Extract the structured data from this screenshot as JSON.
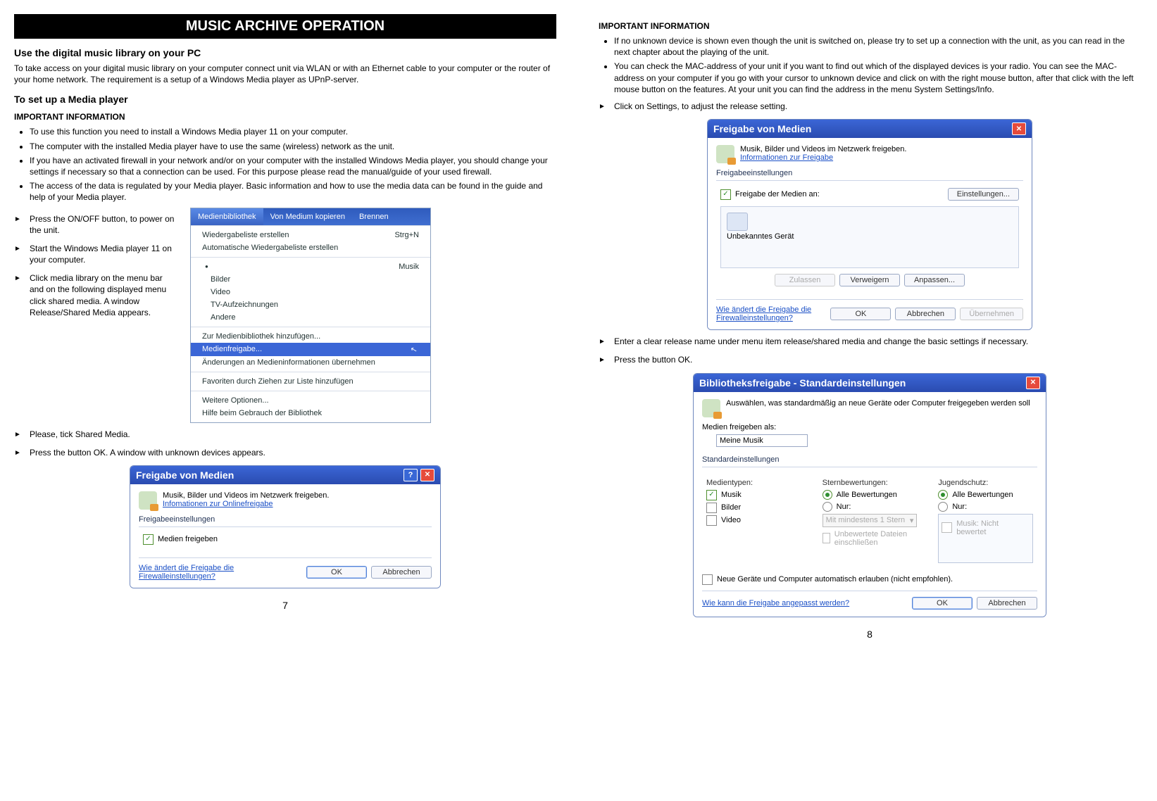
{
  "left": {
    "banner": "MUSIC ARCHIVE OPERATION",
    "h2": "Use the digital music library on your PC",
    "intro": "To take access on your digital music library on your computer connect unit via WLAN or with an Ethernet cable to your computer or the router of your home network. The requirement is a setup of a Windows Media player as UPnP-server.",
    "h3": "To set up a Media player",
    "imp": "IMPORTANT INFORMATION",
    "bullets": [
      "To use this function you need to install a Windows Media player 11 on your computer.",
      "The computer with the installed Media player have to use the same (wireless) network as the unit.",
      "If you have an activated firewall in your network and/or on your computer with the installed Windows Media player, you should change your settings if necessary so that a connection can be used. For this purpose please read the manual/guide of your used firewall.",
      "The access of the data is regulated by your Media player. Basic information and how to use the media data can be found in the guide and help of your Media player."
    ],
    "steps1": [
      "Press the ON/OFF button, to power on the unit.",
      "Start the Windows Media player 11 on your computer.",
      "Click media library on the menu bar and on the following displayed menu click shared media. A window Release/Shared Media appears."
    ],
    "wmp": {
      "tabs": [
        "Medienbibliothek",
        "Von Medium kopieren",
        "Brennen"
      ],
      "g1": [
        {
          "label": "Wiedergabeliste erstellen",
          "accel": "Strg+N"
        },
        {
          "label": "Automatische Wiedergabeliste erstellen",
          "accel": ""
        }
      ],
      "g2": [
        "Musik",
        "Bilder",
        "Video",
        "TV-Aufzeichnungen",
        "Andere"
      ],
      "g3": [
        "Zur Medienbibliothek hinzufügen...",
        "Medienfreigabe...",
        "Änderungen an Medieninformationen übernehmen"
      ],
      "g4": [
        "Favoriten durch Ziehen zur Liste hinzufügen"
      ],
      "g5": [
        "Weitere Optionen...",
        "Hilfe beim Gebrauch der Bibliothek"
      ]
    },
    "steps2": [
      "Please, tick Shared Media.",
      "Press the button OK. A window with unknown devices appears."
    ],
    "dlg1": {
      "title": "Freigabe von Medien",
      "desc": "Musik, Bilder und Videos im Netzwerk freigeben.",
      "link": "Infomationen zur Onlinefreigabe",
      "group": "Freigabeeinstellungen",
      "chk": "Medien freigeben",
      "flink": "Wie ändert die Freigabe die Firewalleinstellungen?",
      "ok": "OK",
      "cancel": "Abbrechen"
    },
    "pagenum": "7"
  },
  "right": {
    "imp": "IMPORTANT INFORMATION",
    "bullets": [
      "If no unknown device is shown even though the unit is switched on, please try to set up a connection with the unit, as you can read in the next chapter about the playing of the unit.",
      "You can check the MAC-address of your unit if you want to find out which of the displayed devices is your radio. You can see the MAC-address on your computer if you go with your cursor to unknown device and click on with the right mouse button, after that click with the left mouse button on the features. At your unit you can find the address in the menu System Settings/Info."
    ],
    "step_settings": "Click on Settings, to adjust the release setting.",
    "dlg2": {
      "title": "Freigabe von Medien",
      "desc": "Musik, Bilder und Videos im Netzwerk freigeben.",
      "link": "Informationen zur Freigabe",
      "group": "Freigabeeinstellungen",
      "chk": "Freigabe der Medien an:",
      "settings_btn": "Einstellungen...",
      "device": "Unbekanntes Gerät",
      "allow": "Zulassen",
      "deny": "Verweigern",
      "custom": "Anpassen...",
      "flink": "Wie ändert die Freigabe die Firewalleinstellungen?",
      "ok": "OK",
      "cancel": "Abbrechen",
      "apply": "Übernehmen"
    },
    "steps3": [
      "Enter a clear release name under menu item release/shared media and change the basic settings if necessary.",
      "Press the button OK."
    ],
    "dlg3": {
      "title": "Bibliotheksfreigabe - Standardeinstellungen",
      "desc": "Auswählen, was standardmäßig an neue Geräte oder Computer freigegeben werden soll",
      "label_as": "Medien freigeben als:",
      "name_val": "Meine Musik",
      "group": "Standardeinstellungen",
      "col1_h": "Medientypen:",
      "col1": [
        "Musik",
        "Bilder",
        "Video"
      ],
      "col2_h": "Sternbewertungen:",
      "col2_opt1": "Alle Bewertungen",
      "col2_opt2": "Nur:",
      "col2_sel": "Mit mindestens 1 Stern",
      "col2_chk": "Unbewertete Dateien einschließen",
      "col3_h": "Jugendschutz:",
      "col3_opt1": "Alle Bewertungen",
      "col3_opt2": "Nur:",
      "col3_list": "Musik: Nicht bewertet",
      "auto": "Neue Geräte und Computer automatisch erlauben (nicht empfohlen).",
      "flink": "Wie kann die Freigabe angepasst werden?",
      "ok": "OK",
      "cancel": "Abbrechen"
    },
    "pagenum": "8"
  }
}
